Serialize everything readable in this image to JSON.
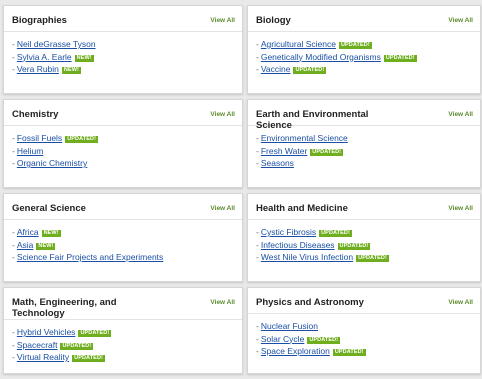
{
  "view_all_label": "View All",
  "badges": {
    "new": "NEW!",
    "updated": "UPDATED!"
  },
  "cards": [
    {
      "title": "Biographies",
      "items": [
        {
          "label": "Neil deGrasse Tyson",
          "badge": ""
        },
        {
          "label": "Sylvia A. Earle",
          "badge": "NEW!"
        },
        {
          "label": "Vera Rubin",
          "badge": "NEW!"
        }
      ]
    },
    {
      "title": "Biology",
      "items": [
        {
          "label": "Agricultural Science",
          "badge": "UPDATED!"
        },
        {
          "label": "Genetically Modified Organisms",
          "badge": "UPDATED!"
        },
        {
          "label": "Vaccine",
          "badge": "UPDATED!"
        }
      ]
    },
    {
      "title": "Chemistry",
      "items": [
        {
          "label": "Fossil Fuels",
          "badge": "UPDATED!"
        },
        {
          "label": "Helium",
          "badge": ""
        },
        {
          "label": "Organic Chemistry",
          "badge": ""
        }
      ]
    },
    {
      "title": "Earth and Environmental Science",
      "items": [
        {
          "label": "Environmental Science",
          "badge": ""
        },
        {
          "label": "Fresh Water",
          "badge": "UPDATED!"
        },
        {
          "label": "Seasons",
          "badge": ""
        }
      ]
    },
    {
      "title": "General Science",
      "items": [
        {
          "label": "Africa",
          "badge": "NEW!"
        },
        {
          "label": "Asia",
          "badge": "NEW!"
        },
        {
          "label": "Science Fair Projects and Experiments",
          "badge": ""
        }
      ]
    },
    {
      "title": "Health and Medicine",
      "items": [
        {
          "label": "Cystic Fibrosis",
          "badge": "UPDATED!"
        },
        {
          "label": "Infectious Diseases",
          "badge": "UPDATED!"
        },
        {
          "label": "West Nile Virus Infection",
          "badge": "UPDATED!"
        }
      ]
    },
    {
      "title": "Math, Engineering, and Technology",
      "items": [
        {
          "label": "Hybrid Vehicles",
          "badge": "UPDATED!"
        },
        {
          "label": "Spacecraft",
          "badge": "UPDATED!"
        },
        {
          "label": "Virtual Reality",
          "badge": "UPDATED!"
        }
      ]
    },
    {
      "title": "Physics and Astronomy",
      "items": [
        {
          "label": "Nuclear Fusion",
          "badge": ""
        },
        {
          "label": "Solar Cycle",
          "badge": "UPDATED!"
        },
        {
          "label": "Space Exploration",
          "badge": "UPDATED!"
        }
      ]
    }
  ],
  "colors": {
    "link": "#1a4fa3",
    "badge_bg": "#6fae1f",
    "view_all": "#5a8a2a"
  }
}
